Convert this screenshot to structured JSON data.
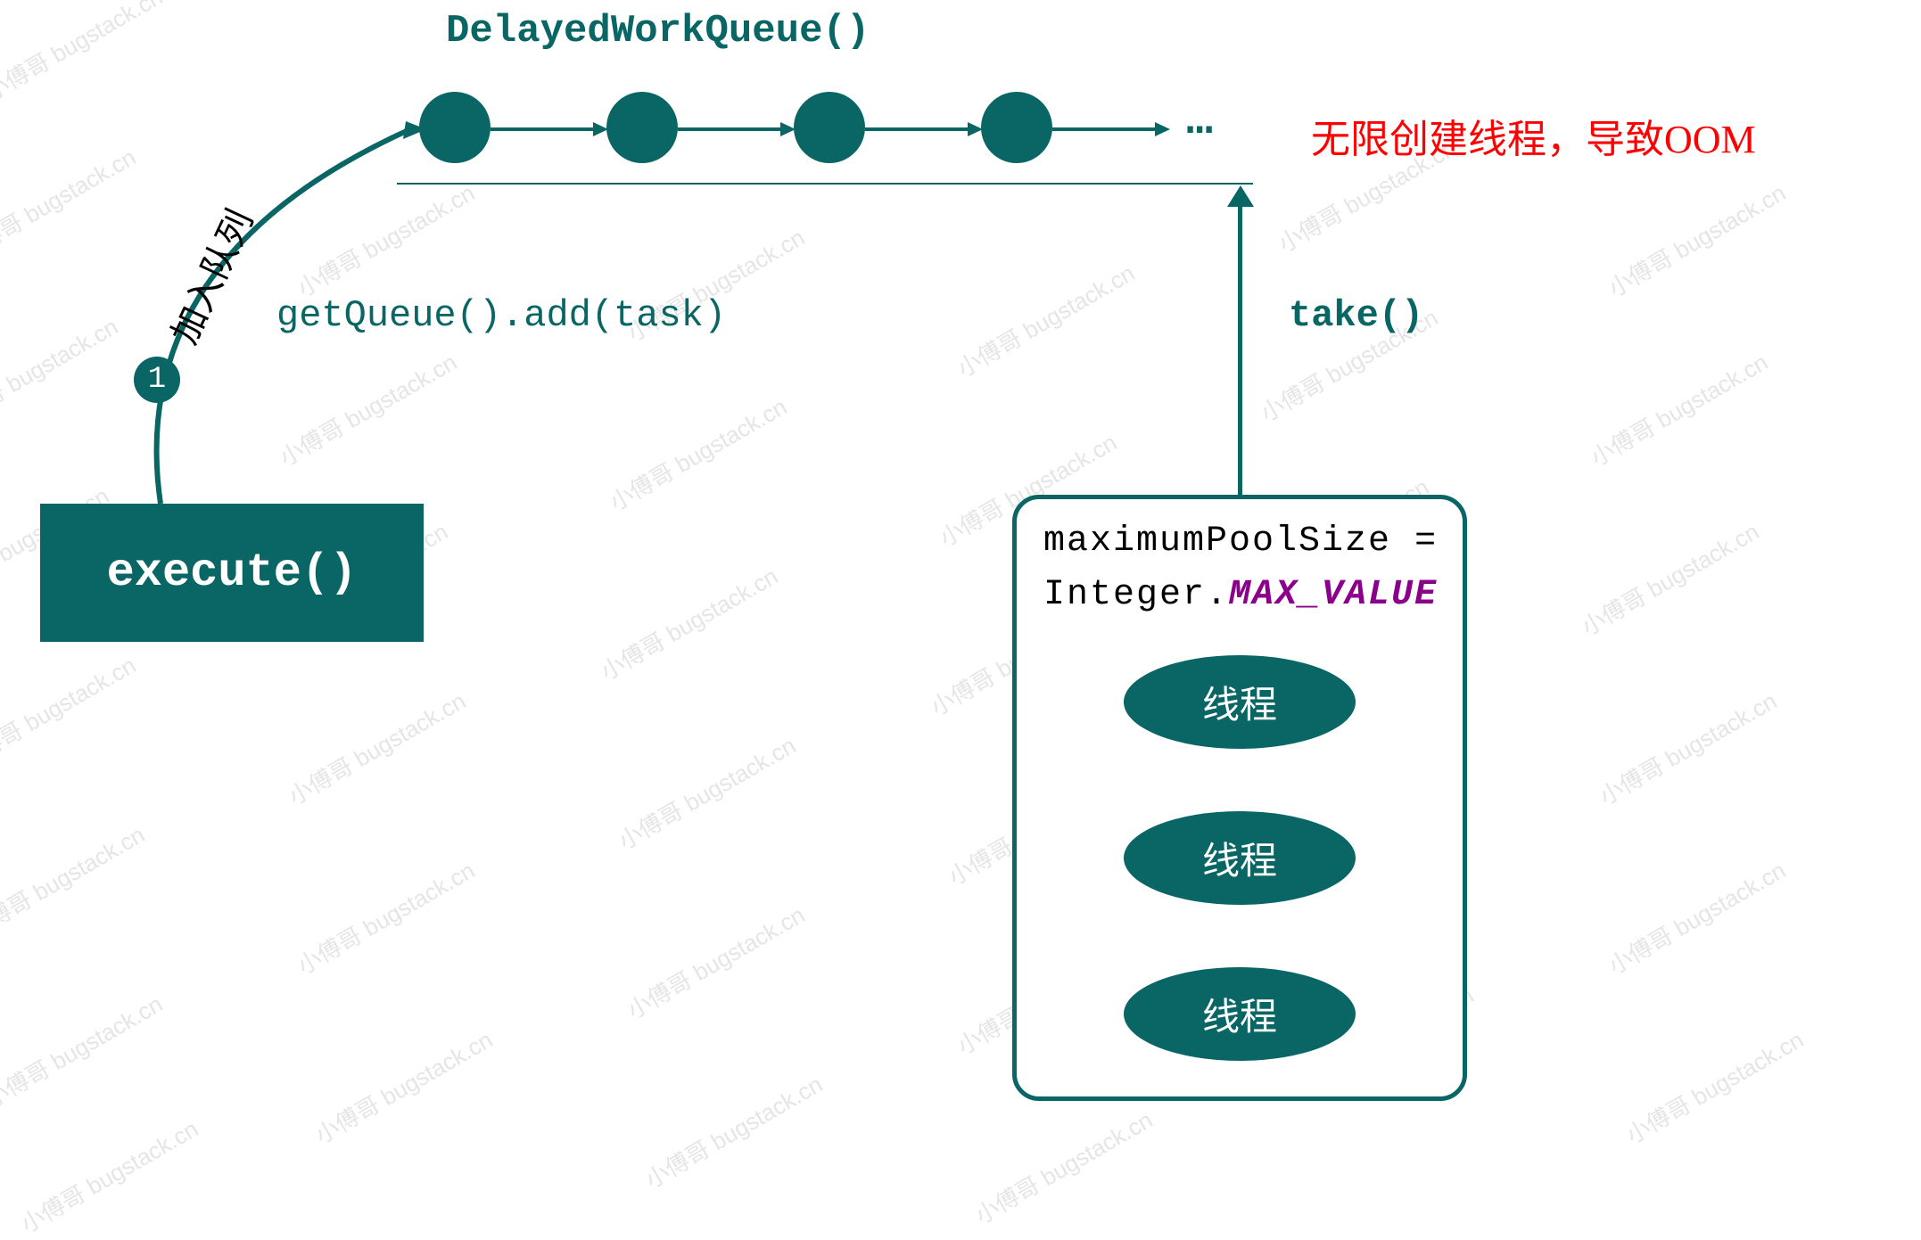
{
  "diagram": {
    "title": "DelayedWorkQueue()",
    "oom_warning": "无限创建线程，导致OOM",
    "ellipsis": "…",
    "execute_label": "execute()",
    "add_queue_label": "getQueue().add(task)",
    "take_label": "take()",
    "badge_number": "1",
    "badge_text": "加入队列",
    "pool": {
      "line1": "maximumPoolSize =",
      "line2_prefix": "Integer.",
      "line2_value": "MAX_VALUE",
      "thread_label": "线程"
    }
  },
  "watermark_text": "小傅哥 bugstack.cn"
}
